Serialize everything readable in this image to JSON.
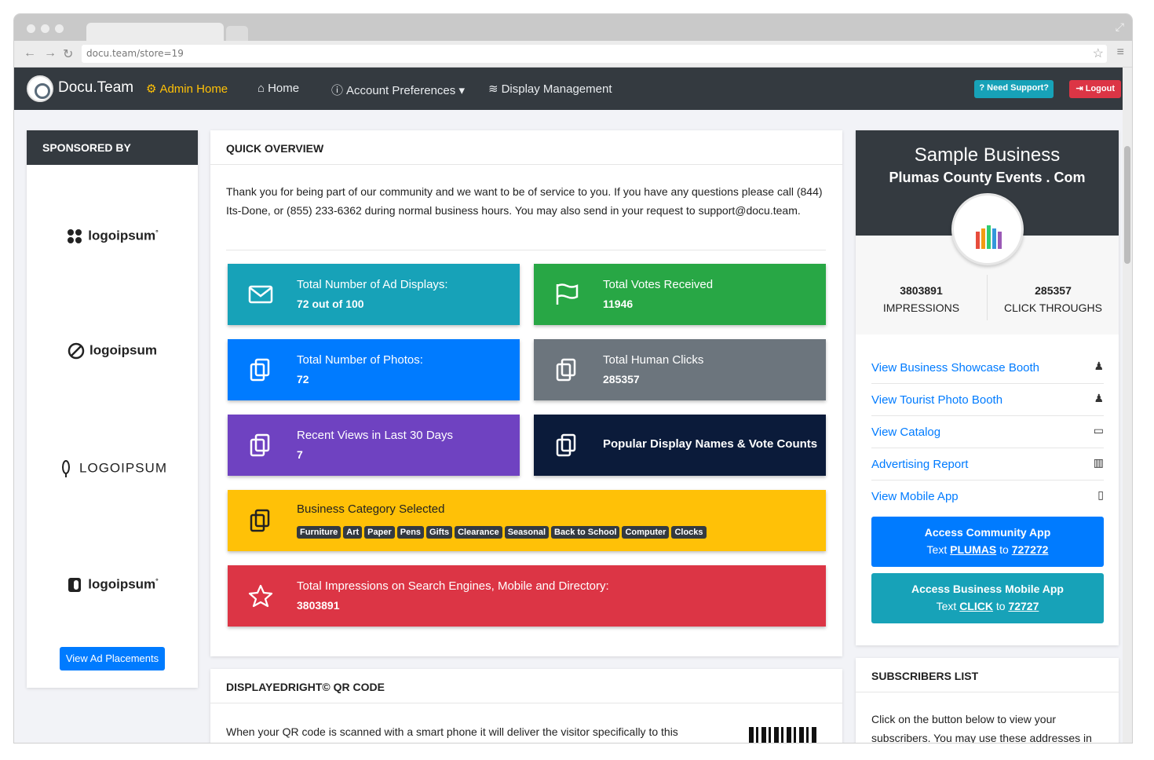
{
  "browser": {
    "url": "docu.team/store=19"
  },
  "nav": {
    "brand": "Docu.Team",
    "items": [
      {
        "label": "Admin Home"
      },
      {
        "label": "Home"
      },
      {
        "label": "Account Preferences"
      },
      {
        "label": "Display Management"
      }
    ],
    "support_label": "Need Support?",
    "logout_label": "Logout"
  },
  "sponsor": {
    "title": "SPONSORED BY",
    "logos": [
      "logoipsum",
      "logoipsum",
      "LOGOIPSUM",
      "logoipsum"
    ],
    "button_label": "View Ad Placements"
  },
  "overview": {
    "title": "QUICK OVERVIEW",
    "intro": "Thank you for being part of our community and we want to be of service to you. If you have any questions please call (844) Its-Done, or (855) 233-6362 during normal business hours. You may also send in your request to support@docu.team.",
    "tiles": {
      "ad_displays": {
        "label": "Total Number of Ad Displays:",
        "value": "72 out of 100"
      },
      "votes": {
        "label": "Total Votes Received",
        "value": "11946"
      },
      "photos": {
        "label": "Total Number of Photos:",
        "value": "72"
      },
      "human_clicks": {
        "label": "Total Human Clicks",
        "value": "285357"
      },
      "recent_views": {
        "label": "Recent Views in Last 30 Days",
        "value": "7"
      },
      "popular": {
        "label": "Popular Display Names & Vote Counts"
      },
      "category": {
        "label": "Business Category Selected",
        "tags": [
          "Furniture",
          "Art",
          "Paper",
          "Pens",
          "Gifts",
          "Clearance",
          "Seasonal",
          "Back to School",
          "Computer",
          "Clocks"
        ]
      },
      "impressions": {
        "label": "Total Impressions on Search Engines, Mobile and Directory:",
        "value": "3803891"
      }
    },
    "colors": {
      "teal": "#17a2b8",
      "green": "#28a745",
      "blue": "#007bff",
      "gray": "#6c757d",
      "purple": "#6f42c1",
      "navy": "#0b1b3a",
      "yellow": "#ffc107",
      "red": "#dc3545"
    }
  },
  "qr": {
    "title": "DISPLAYEDRIGHT© QR CODE",
    "text": "When your QR code is scanned with a smart phone it will deliver the visitor specifically to this"
  },
  "business": {
    "name": "Sample Business",
    "subtitle": "Plumas County Events . Com",
    "impressions": "3803891",
    "impressions_label": "IMPRESSIONS",
    "clicks": "285357",
    "clicks_label": "CLICK THROUGHS",
    "links": [
      {
        "label": "View Business Showcase Booth",
        "icon": "person-icon"
      },
      {
        "label": "View Tourist Photo Booth",
        "icon": "person-icon"
      },
      {
        "label": "View Catalog",
        "icon": "store-icon"
      },
      {
        "label": "Advertising Report",
        "icon": "chart-icon"
      },
      {
        "label": "View Mobile App",
        "icon": "mobile-icon"
      }
    ],
    "community_btn": {
      "title": "Access Community App",
      "text": "Text",
      "keyword": "PLUMAS",
      "to": "to",
      "number": "727272"
    },
    "mobile_btn": {
      "title": "Access Business Mobile App",
      "text": "Text",
      "keyword": "CLICK",
      "to": "to",
      "number": "72727"
    }
  },
  "subscribers": {
    "title": "SUBSCRIBERS LIST",
    "text": "Click on the button below to view your subscribers. You may use these addresses in"
  }
}
